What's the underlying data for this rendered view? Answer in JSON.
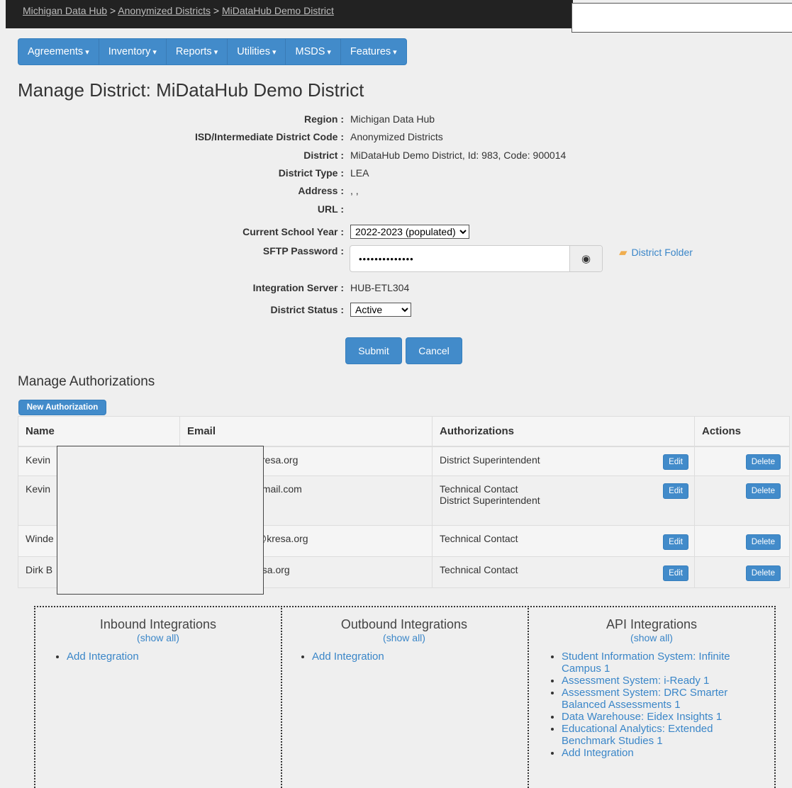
{
  "breadcrumb": [
    "Michigan Data Hub",
    "Anonymized Districts",
    "MiDataHub Demo District"
  ],
  "breadcrumb_sep": ">",
  "nav": [
    "Agreements",
    "Inventory",
    "Reports",
    "Utilities",
    "MSDS",
    "Features"
  ],
  "page_title": "Manage District: MiDataHub Demo District",
  "form": {
    "region_label": "Region :",
    "region": "Michigan Data Hub",
    "isd_label": "ISD/Intermediate District Code :",
    "isd": "Anonymized Districts",
    "district_label": "District :",
    "district": "MiDataHub Demo District, Id: 983, Code: 900014",
    "type_label": "District Type :",
    "type": "LEA",
    "address_label": "Address :",
    "address": ", ,",
    "url_label": "URL :",
    "url": "",
    "year_label": "Current School Year :",
    "year": "2022-2023 (populated)",
    "sftp_label": "SFTP Password :",
    "sftp_mask": "••••••••••••••",
    "folder_link": "District Folder",
    "server_label": "Integration Server :",
    "server": "HUB-ETL304",
    "status_label": "District Status :",
    "status": "Active"
  },
  "buttons": {
    "submit": "Submit",
    "cancel": "Cancel",
    "new_auth": "New Authorization",
    "edit": "Edit",
    "delete": "Delete"
  },
  "auth_section_title": "Manage Authorizations",
  "auth_table": {
    "headers": [
      "Name",
      "Email",
      "Authorizations",
      "Actions"
    ],
    "rows": [
      {
        "name": "Kevin",
        "email": "kresa.org",
        "auths": [
          "District Superintendent"
        ]
      },
      {
        "name": "Kevin",
        "email": "gmail.com",
        "auths": [
          "Technical Contact",
          "District Superintendent"
        ]
      },
      {
        "name": "Winde",
        "email": "@kresa.org",
        "auths": [
          "Technical Contact"
        ]
      },
      {
        "name": "Dirk B",
        "email": "esa.org",
        "auths": [
          "Technical Contact"
        ]
      }
    ]
  },
  "integrations": {
    "show_all": "(show all)",
    "inbound": {
      "title": "Inbound Integrations",
      "items": [
        "Add Integration"
      ]
    },
    "outbound": {
      "title": "Outbound Integrations",
      "items": [
        "Add Integration"
      ]
    },
    "api": {
      "title": "API Integrations",
      "items": [
        "Student Information System: Infinite Campus 1",
        "Assessment System: i-Ready 1",
        "Assessment System: DRC Smarter Balanced Assessments 1",
        "Data Warehouse: Eidex Insights 1",
        "Educational Analytics: Extended Benchmark Studies 1",
        "Add Integration"
      ]
    }
  }
}
